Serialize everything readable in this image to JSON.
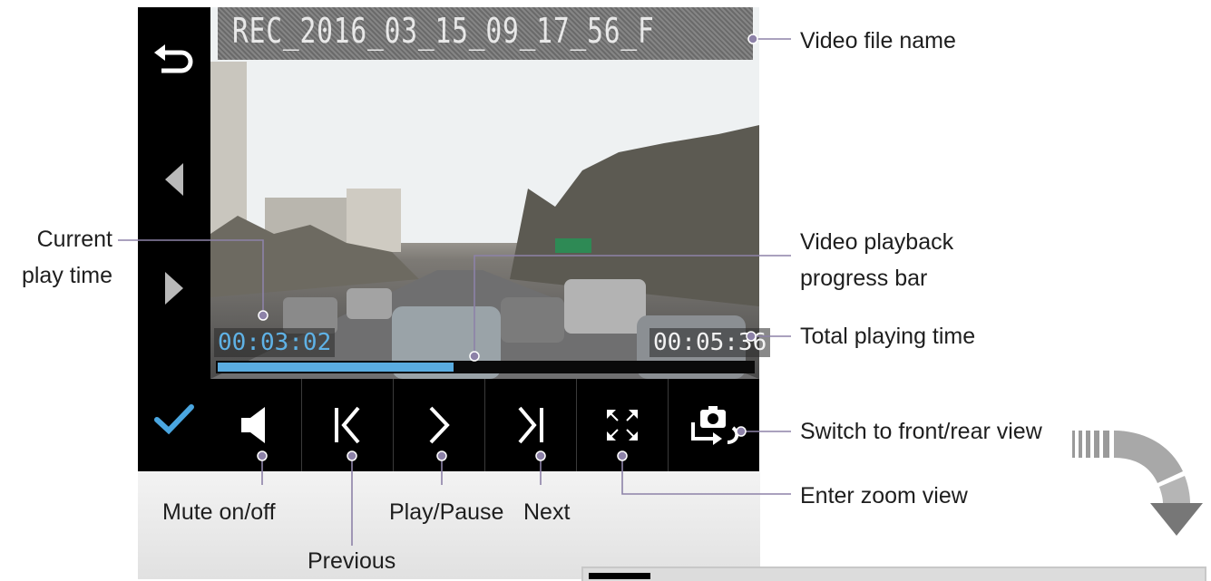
{
  "video": {
    "file_name": "REC_2016_03_15_09_17_56_F",
    "current_time": "00:03:02",
    "total_time": "00:05:36",
    "progress_fraction": 0.44
  },
  "sidebar": {
    "icons": [
      "back-icon",
      "left-triangle-icon",
      "right-triangle-icon",
      "checkmark-icon"
    ]
  },
  "controls": {
    "icons": [
      "speaker-icon",
      "previous-icon",
      "play-icon",
      "next-icon",
      "zoom-icon",
      "camera-switch-icon"
    ]
  },
  "annotations": {
    "video_file_name": "Video file name",
    "current_play_time": [
      "Current",
      "play time"
    ],
    "progress_bar": [
      "Video playback",
      "progress bar"
    ],
    "total_playing_time": "Total playing time",
    "switch_view": "Switch to front/rear view",
    "zoom_view": "Enter zoom view",
    "mute": "Mute on/off",
    "previous": "Previous",
    "play_pause": "Play/Pause",
    "next": "Next"
  },
  "colors": {
    "accent_blue": "#5aace0",
    "leader_line": "#8d82a8"
  }
}
